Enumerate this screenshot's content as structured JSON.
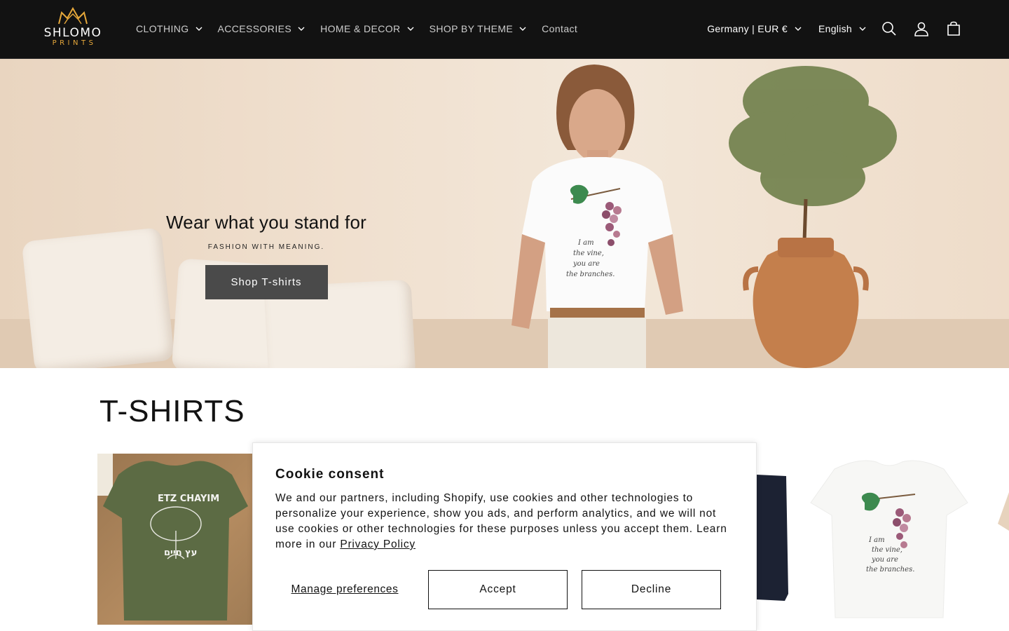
{
  "brand": {
    "name_line1": "SHLOMO",
    "name_line2": "PRINTS",
    "accent": "#e7a83a"
  },
  "nav": {
    "items": [
      {
        "label": "CLOTHING",
        "has_dropdown": true
      },
      {
        "label": "ACCESSORIES",
        "has_dropdown": true
      },
      {
        "label": "HOME & DECOR",
        "has_dropdown": true
      },
      {
        "label": "SHOP BY THEME",
        "has_dropdown": true
      },
      {
        "label": "Contact",
        "has_dropdown": false
      }
    ]
  },
  "header_right": {
    "country": "Germany | EUR €",
    "language": "English",
    "icons": [
      "search-icon",
      "account-icon",
      "cart-icon"
    ]
  },
  "hero": {
    "title": "Wear what you stand for",
    "subtitle": "FASHION WITH MEANING.",
    "button": "Shop T-shirts",
    "shirt_print": {
      "line1": "I am",
      "line2": "the vine,",
      "line3": "you are",
      "line4": "the branches."
    }
  },
  "collection": {
    "title": "T-SHIRTS",
    "card1_print": {
      "top": "ETZ CHAYIM",
      "bottom": "עץ חיים"
    },
    "card3_print": {
      "line1": "I am",
      "line2": "the vine,",
      "line3": "you are",
      "line4": "the branches."
    }
  },
  "cookie": {
    "title": "Cookie consent",
    "body": "We and our partners, including Shopify, use cookies and other technologies to personalize your experience, show you ads, and perform analytics, and we will not use cookies or other technologies for these purposes unless you accept them. Learn more in our ",
    "privacy_link": "Privacy Policy",
    "manage": "Manage preferences",
    "accept": "Accept",
    "decline": "Decline"
  },
  "colors": {
    "header_bg": "#121212",
    "button_dark": "#4a4a4a"
  }
}
